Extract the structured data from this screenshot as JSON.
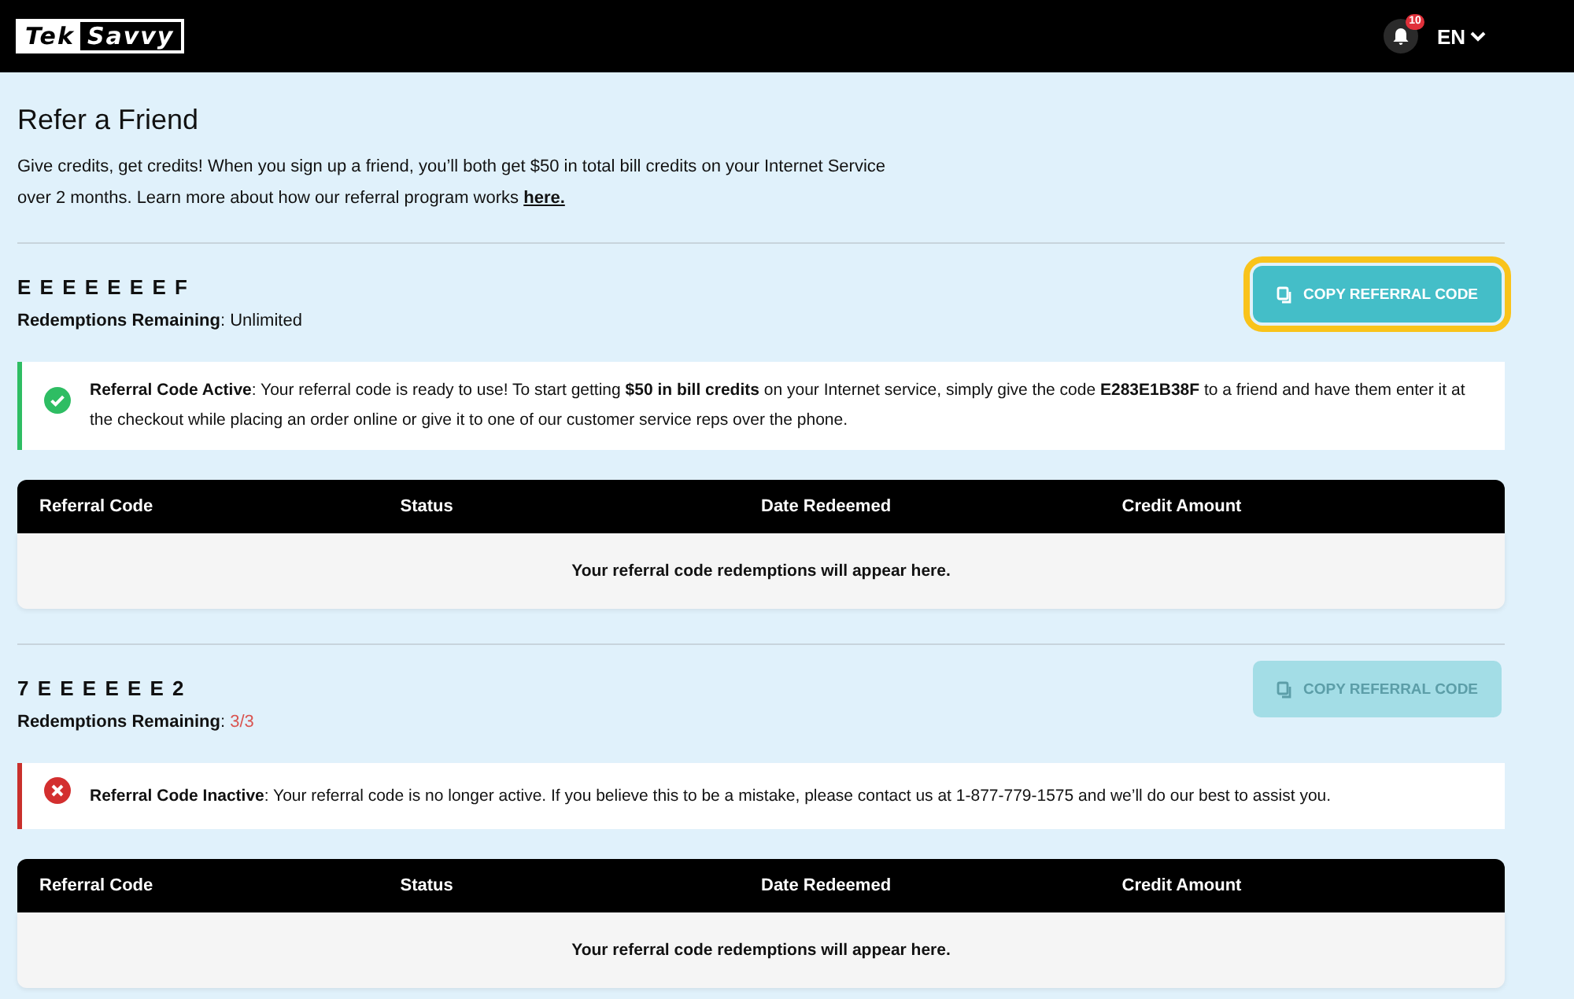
{
  "header": {
    "logo": [
      "Tek",
      "Savvy"
    ],
    "notification_count": "10",
    "language": "EN"
  },
  "page": {
    "title": "Refer a Friend",
    "intro": "Give credits, get credits! When you sign up a friend, you’ll both get $50 in total bill credits on your Internet Service over 2 months. Learn more about how our referral program works",
    "intro_link": "here."
  },
  "referrals": [
    {
      "code": "E E E E E E E F",
      "remaining_label": "Redemptions Remaining",
      "separator": ":",
      "remaining": "Unlimited",
      "active": true,
      "button": {
        "label": "COPY REFERRAL CODE",
        "disabled": false,
        "focused": true
      },
      "alert": {
        "title": "Referral Code Active",
        "message": ": Your referral code is ready to use! To start getting **$50 in bill credits** on your Internet service, simply give the code **E283E1B38F** to a friend and have them enter it at the checkout while placing an order online or give it to one of our customer service reps over the phone."
      },
      "table": {
        "columns": [
          "Referral Code",
          "Status",
          "Date Redeemed",
          "Credit Amount"
        ],
        "empty_message": "Your referral code redemptions will appear here."
      }
    },
    {
      "code": "7 E E E E E E 2",
      "remaining_label": "Redemptions Remaining",
      "separator": ":",
      "remaining": "3/3",
      "active": false,
      "button": {
        "label": "COPY REFERRAL CODE",
        "disabled": true,
        "focused": false
      },
      "alert": {
        "title": "Referral Code Inactive",
        "message": ": Your referral code is no longer active. If you believe this to be a mistake, please contact us at 1-877-779-1575 and we’ll do our best to assist you."
      },
      "table": {
        "columns": [
          "Referral Code",
          "Status",
          "Date Redeemed",
          "Credit Amount"
        ],
        "empty_message": "Your referral code redemptions will appear here."
      }
    }
  ]
}
